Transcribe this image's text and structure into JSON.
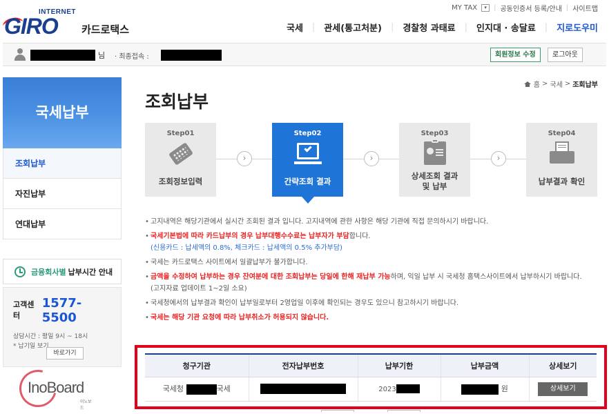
{
  "header": {
    "logo_small": "INTERNET",
    "logo_main": "GIRO",
    "logo_sub": "카드로택스",
    "util": [
      "MY TAX",
      "공동인증서 등록/안내",
      "사이트맵"
    ],
    "nav": [
      "국세",
      "관세(통고처분)",
      "경찰청 과태료",
      "인지대 · 송달료",
      "지로도우미"
    ]
  },
  "userbar": {
    "suffix": "님",
    "last_login_label": "· 최종접속 :",
    "edit_label": "회원정보 수정",
    "logout_label": "로그아웃"
  },
  "sidebar": {
    "title": "국세납부",
    "items": [
      "조회납부",
      "자진납부",
      "연대납부"
    ],
    "bank_time_green": "금융회사별",
    "bank_time_rest": "납부시간 안내",
    "cc_label": "고객센터",
    "cc_tel": "1577-5500",
    "cc_hours": "상담시간 : 평일 9시 ~ 18시",
    "cc_holiday": "* 납기일 보기",
    "go_label": "바로가기",
    "partner_logo": "InoBoard",
    "partner_sub": "이노보드"
  },
  "breadcrumb": {
    "home": "홈",
    "l1": "국세",
    "l2": "조회납부"
  },
  "page": {
    "title": "조회납부"
  },
  "steps": [
    {
      "label": "Step01",
      "name": "조회정보입력"
    },
    {
      "label": "Step02",
      "name": "간략조회 결과"
    },
    {
      "label": "Step03",
      "name": "상세조회 결과 및 납부"
    },
    {
      "label": "Step04",
      "name": "납부결과 확인"
    }
  ],
  "notices": {
    "n1": "고지내역은 해당기관에서 실시간 조회된 결과 입니다. 고지내역에 관한 사항은 해당 기관에 직접 문의하시기 바랍니다.",
    "n2_red": "국세기본법에 따라 카드납부의 경우 납부대행수수료는 납부자가 부담",
    "n2_rest": "합니다.",
    "n2_blue": "(신용카드 : 납세액의 0.8%, 체크카드 : 납세액의 0.5% 추가부담)",
    "n3": "국세는 카드로택스 사이트에서 일괄납부가 불가합니다.",
    "n4_red": "금액을 수정하여 납부하는 경우 잔여분에 대한 조회납부는 당일에 한해 재납부 가능",
    "n4_rest": "하며, 익일 납부 시 국세청 홈택스사이트에서 납부하시기 바랍니다. (고지자료 업데이트 1~2일 소요)",
    "n5": "국세청에서의 납부결과 확인이 납부일로부터 2영업일 이후에 확인되는 경우도 있으니 참고하시기 바랍니다.",
    "n6": "국세는 해당 기관 요청에 따라 납부취소가 허용되지 않습니다."
  },
  "table": {
    "headers": [
      "청구기관",
      "전자납부번호",
      "납부기한",
      "납부금액",
      "상세보기"
    ],
    "row": {
      "agency_pre": "국세청",
      "agency_post": "국세",
      "due_prefix": "2023",
      "amount_unit": "원",
      "detail_label": "상세보기"
    }
  },
  "colors": {
    "primary": "#1f74d8",
    "brand": "#1a3f8f",
    "alert": "#e22222",
    "highlight_frame": "#e2001a"
  }
}
